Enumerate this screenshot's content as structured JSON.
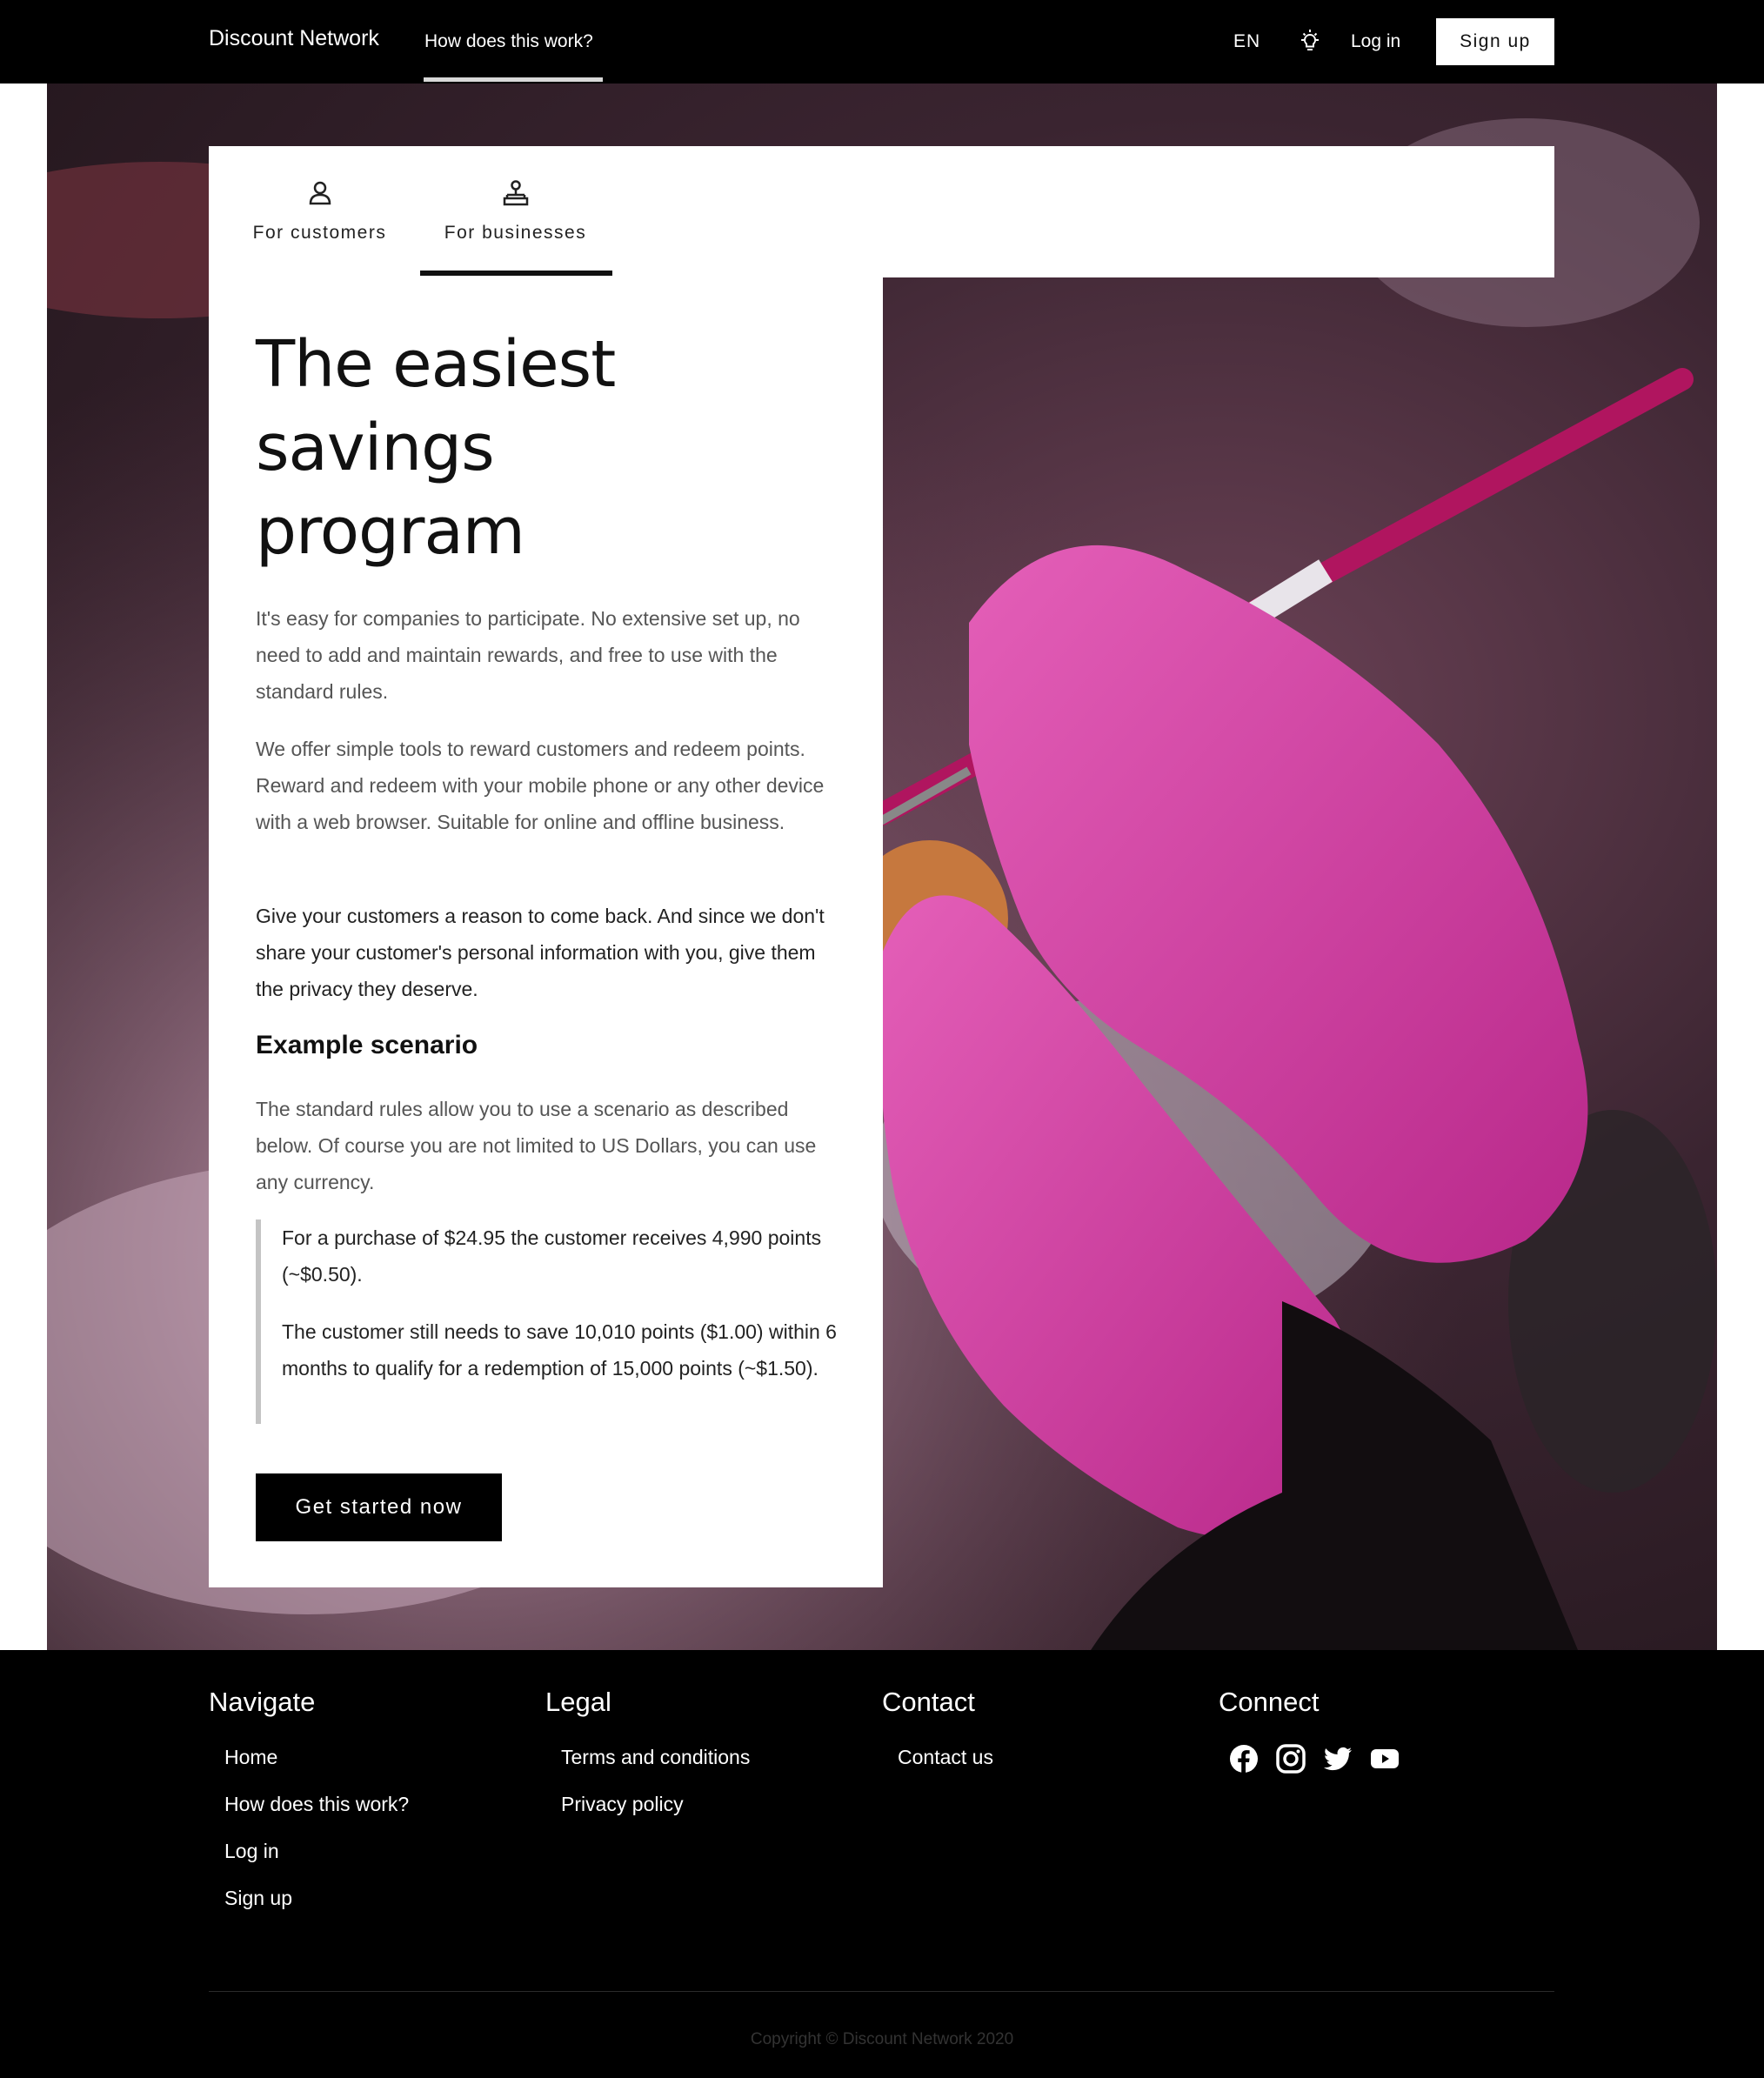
{
  "header": {
    "brand": "Discount Network",
    "nav_link": "How does this work?",
    "language": "EN",
    "login": "Log in",
    "signup": "Sign up"
  },
  "tabs": [
    {
      "label": "For customers",
      "icon": "person-icon",
      "active": false
    },
    {
      "label": "For businesses",
      "icon": "network-icon",
      "active": true
    }
  ],
  "content": {
    "title_lines": [
      "The easiest",
      "savings",
      "program"
    ],
    "para1": "It's easy for companies to participate. No extensive set up, no need to add and maintain rewards, and free to use with the standard rules.",
    "para2": "We offer simple tools to reward customers and redeem points. Reward and redeem with your mobile phone or any other device with a web browser. Suitable for online and offline business.",
    "para3": "Give your customers a reason to come back. And since we don't share your customer's personal information with you, give them the privacy they deserve.",
    "scenario_heading": "Example scenario",
    "scenario_intro": "The standard rules allow you to use a scenario as described below. Of course you are not limited to US Dollars, you can use any currency.",
    "quote1": "For a purchase of $24.95 the customer receives 4,990 points (~$0.50).",
    "quote2": "The customer still needs to save 10,010 points ($1.00) within 6 months to qualify for a redemption of 15,000 points (~$1.50).",
    "cta": "Get started now"
  },
  "footer": {
    "navigate": {
      "heading": "Navigate",
      "links": [
        "Home",
        "How does this work?",
        "Log in",
        "Sign up"
      ]
    },
    "legal": {
      "heading": "Legal",
      "links": [
        "Terms and conditions",
        "Privacy policy"
      ]
    },
    "contact": {
      "heading": "Contact",
      "links": [
        "Contact us"
      ]
    },
    "connect": {
      "heading": "Connect",
      "icons": [
        "facebook-icon",
        "instagram-icon",
        "twitter-icon",
        "youtube-icon"
      ]
    },
    "copyright": "Copyright © Discount Network 2020"
  },
  "colors": {
    "nav_bg": "#000000",
    "glove_pink": "#d63fa5",
    "brush_magenta": "#b0155f"
  }
}
